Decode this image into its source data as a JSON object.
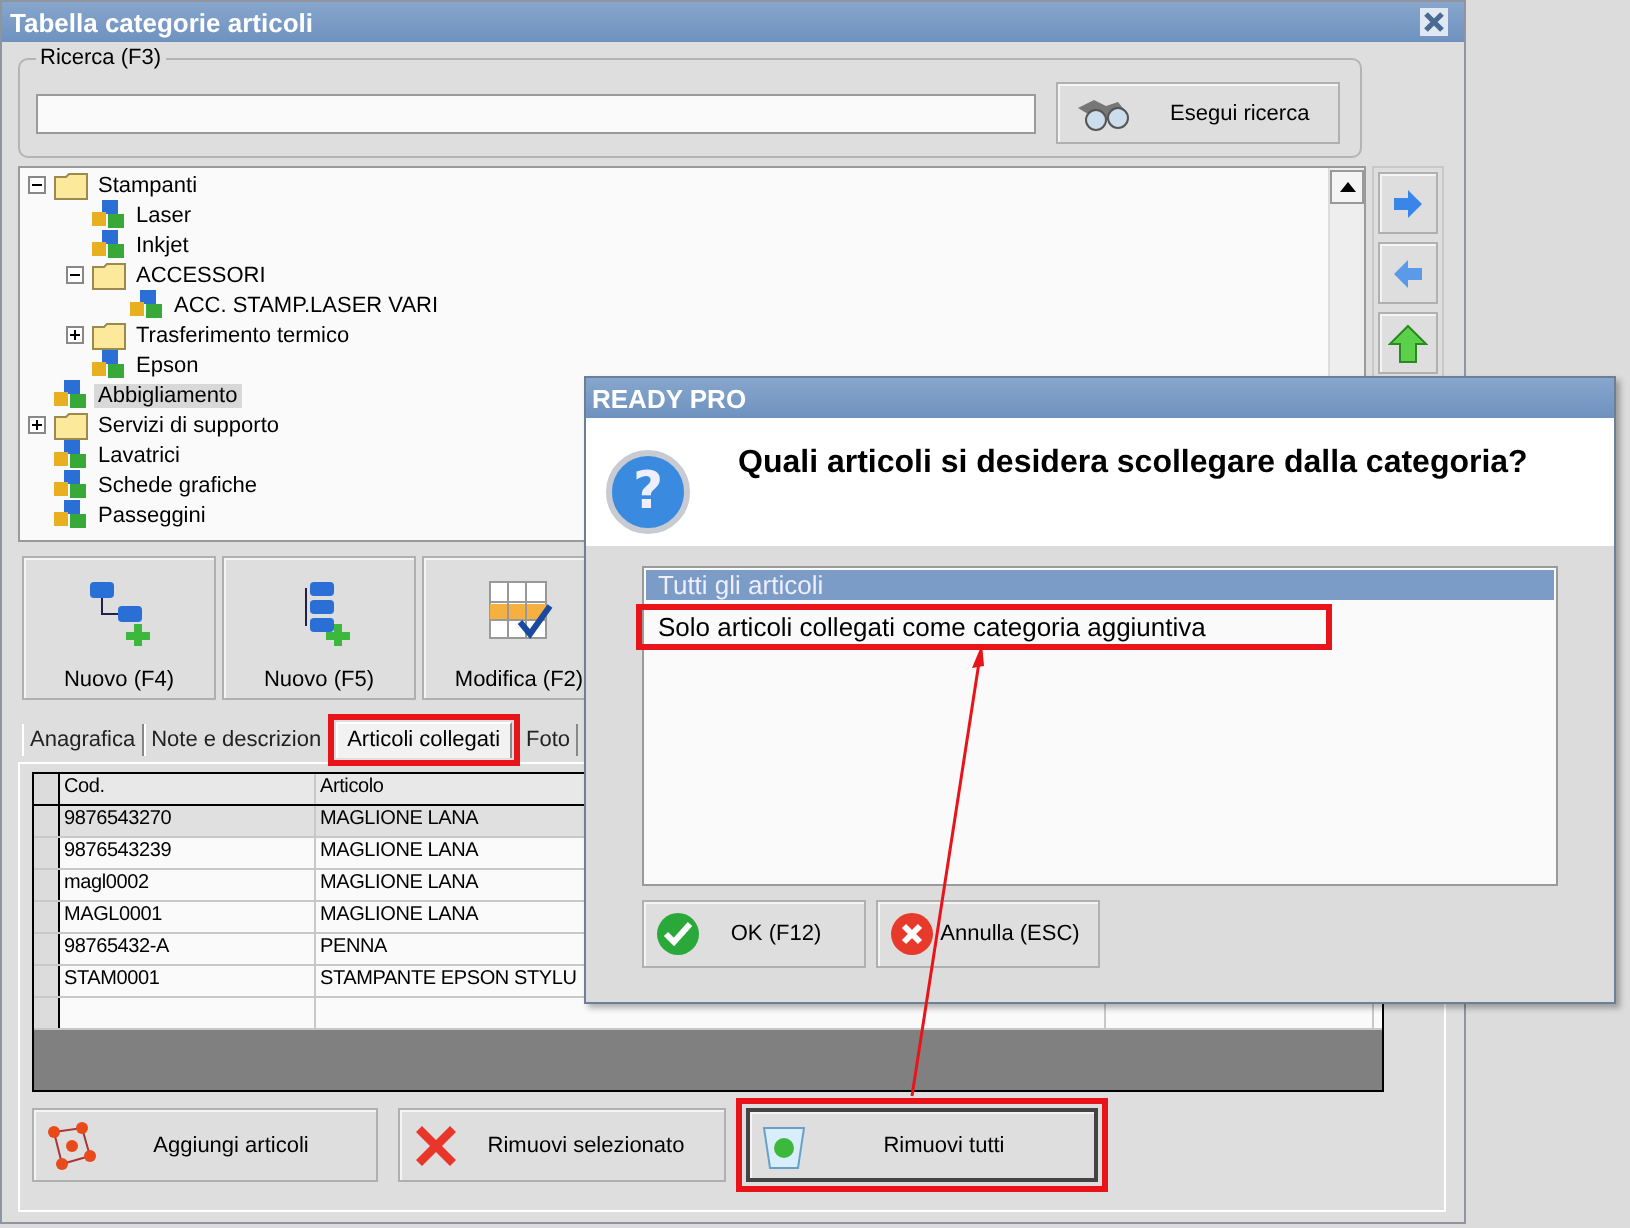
{
  "window": {
    "title": "Tabella categorie articoli"
  },
  "search": {
    "legend": "Ricerca (F3)",
    "button": "Esegui ricerca"
  },
  "tree": [
    {
      "label": "Stampanti",
      "kind": "folder",
      "expanded": true,
      "selected": false,
      "children": [
        {
          "label": "Laser",
          "kind": "category",
          "selected": false
        },
        {
          "label": "Inkjet",
          "kind": "category",
          "selected": false
        },
        {
          "label": "ACCESSORI",
          "kind": "folder",
          "expanded": true,
          "selected": false,
          "children": [
            {
              "label": "ACC. STAMP.LASER VARI",
              "kind": "category",
              "selected": false
            }
          ]
        },
        {
          "label": "Trasferimento termico",
          "kind": "folder",
          "expanded": false,
          "selected": false
        },
        {
          "label": "Epson",
          "kind": "category",
          "selected": false
        }
      ]
    },
    {
      "label": "Abbigliamento",
      "kind": "category",
      "selected": true
    },
    {
      "label": "Servizi di supporto",
      "kind": "folder",
      "expanded": false,
      "selected": false
    },
    {
      "label": "Lavatrici",
      "kind": "category",
      "selected": false
    },
    {
      "label": "Schede grafiche",
      "kind": "category",
      "selected": false
    },
    {
      "label": "Passeggini",
      "kind": "category",
      "selected": false
    }
  ],
  "toolbar": [
    {
      "label": "Nuovo (F4)",
      "kind": "new-child"
    },
    {
      "label": "Nuovo (F5)",
      "kind": "new-sibling"
    },
    {
      "label": "Modifica (F2)",
      "kind": "edit"
    }
  ],
  "tabs": [
    {
      "label": "Anagrafica",
      "selected": false,
      "highlighted": false
    },
    {
      "label": "Note e descrizion",
      "selected": false,
      "highlighted": false
    },
    {
      "label": "Articoli collegati",
      "selected": true,
      "highlighted": true
    },
    {
      "label": "Foto",
      "selected": false,
      "highlighted": false
    }
  ],
  "grid": {
    "columns": [
      "Cod.",
      "Articolo"
    ],
    "rows": [
      {
        "cells": [
          "9876543270",
          "MAGLIONE LANA"
        ],
        "selected": true
      },
      {
        "cells": [
          "9876543239",
          "MAGLIONE LANA"
        ],
        "selected": false
      },
      {
        "cells": [
          "magl0002",
          "MAGLIONE LANA"
        ],
        "selected": false
      },
      {
        "cells": [
          "MAGL0001",
          "MAGLIONE LANA"
        ],
        "selected": false
      },
      {
        "cells": [
          "98765432-A",
          "PENNA"
        ],
        "selected": false
      },
      {
        "cells": [
          "STAM0001",
          "STAMPANTE EPSON STYLU"
        ],
        "selected": false
      }
    ]
  },
  "actions": [
    {
      "label": "Aggiungi articoli",
      "kind": "add",
      "highlighted": false
    },
    {
      "label": "Rimuovi selezionato",
      "kind": "remove",
      "highlighted": false
    },
    {
      "label": "Rimuovi tutti",
      "kind": "clear",
      "highlighted": true
    }
  ],
  "dialog": {
    "title": "READY PRO",
    "icon": "?",
    "question": "Quali articoli si desidera scollegare dalla categoria?",
    "options": [
      {
        "label": "Tutti gli articoli",
        "selected": true,
        "highlighted": false
      },
      {
        "label": "Solo articoli collegati come categoria aggiuntiva",
        "selected": false,
        "highlighted": true
      }
    ],
    "buttons": [
      {
        "label": "OK (F12)",
        "kind": "ok"
      },
      {
        "label": "Annulla (ESC)",
        "kind": "cancel"
      }
    ]
  }
}
